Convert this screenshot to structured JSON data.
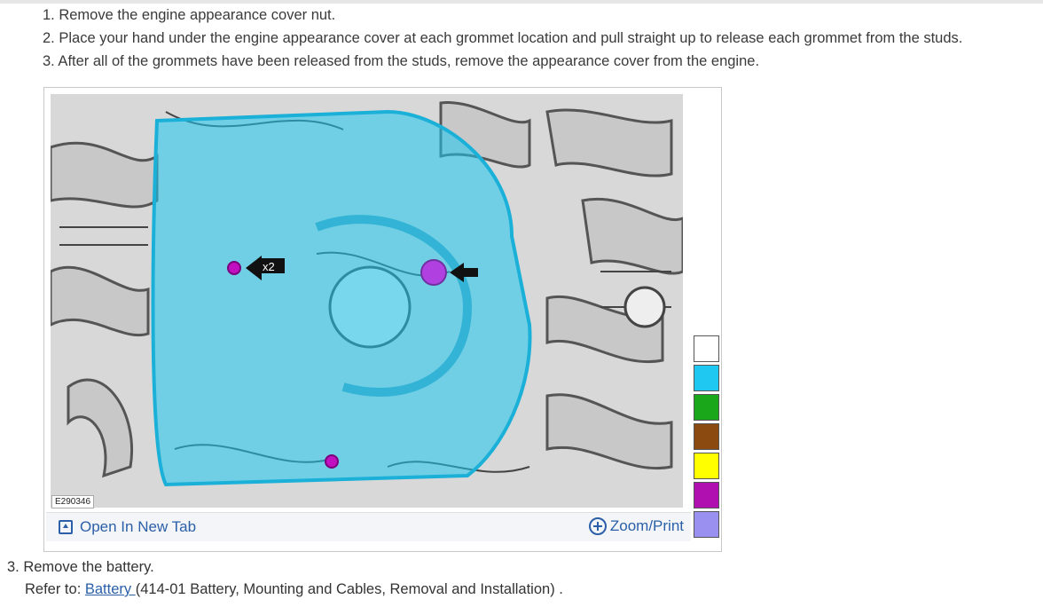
{
  "steps": [
    "1. Remove the engine appearance cover nut.",
    "2. Place your hand under the engine appearance cover at each grommet location and pull straight up to release each grommet from the studs.",
    "3. After all of the grommets have been released from the studs, remove the appearance cover from the engine."
  ],
  "figure": {
    "id_label": "E290346",
    "callout_label": "x2",
    "open_tab_label": "Open In New Tab",
    "zoom_label": "Zoom/Print",
    "swatch_colors": [
      "#ffffff",
      "#1ec8f0",
      "#1aa81a",
      "#8a4a10",
      "#ffff00",
      "#b010b0",
      "#9a90f0"
    ]
  },
  "next_step": "3. Remove the battery.",
  "refer": {
    "prefix": "Refer to: ",
    "link": "Battery ",
    "suffix": "(414-01 Battery, Mounting and Cables, Removal and Installation) ."
  }
}
